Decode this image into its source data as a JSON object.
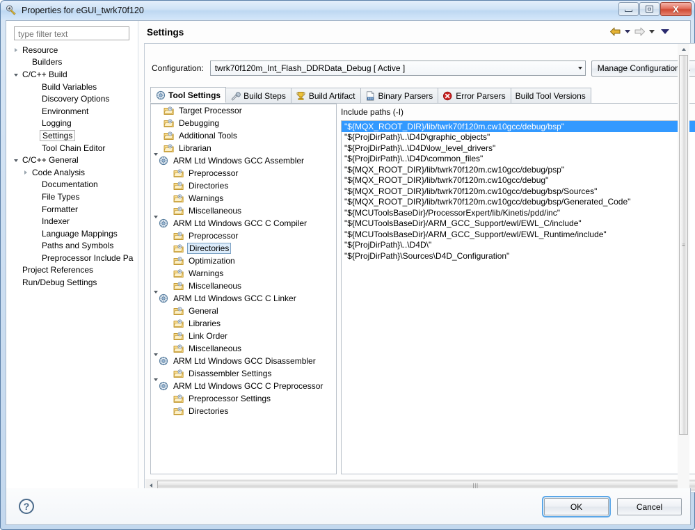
{
  "window": {
    "title": "Properties for eGUI_twrk70f120",
    "icon": "eclipse-properties-icon",
    "controls": {
      "minimize": "Minimize",
      "maximize": "Restore",
      "close": "Close"
    }
  },
  "sidebar": {
    "filter_placeholder": "type filter text",
    "items": [
      {
        "label": "Resource",
        "indent": 0,
        "twisty": "collapsed",
        "selected": false
      },
      {
        "label": "Builders",
        "indent": 1,
        "twisty": "none",
        "selected": false
      },
      {
        "label": "C/C++ Build",
        "indent": 0,
        "twisty": "expanded",
        "selected": false
      },
      {
        "label": "Build Variables",
        "indent": 2,
        "twisty": "none",
        "selected": false
      },
      {
        "label": "Discovery Options",
        "indent": 2,
        "twisty": "none",
        "selected": false
      },
      {
        "label": "Environment",
        "indent": 2,
        "twisty": "none",
        "selected": false
      },
      {
        "label": "Logging",
        "indent": 2,
        "twisty": "none",
        "selected": false
      },
      {
        "label": "Settings",
        "indent": 2,
        "twisty": "none",
        "selected": true
      },
      {
        "label": "Tool Chain Editor",
        "indent": 2,
        "twisty": "none",
        "selected": false
      },
      {
        "label": "C/C++ General",
        "indent": 0,
        "twisty": "expanded",
        "selected": false
      },
      {
        "label": "Code Analysis",
        "indent": 1,
        "twisty": "collapsed",
        "selected": false
      },
      {
        "label": "Documentation",
        "indent": 2,
        "twisty": "none",
        "selected": false
      },
      {
        "label": "File Types",
        "indent": 2,
        "twisty": "none",
        "selected": false
      },
      {
        "label": "Formatter",
        "indent": 2,
        "twisty": "none",
        "selected": false
      },
      {
        "label": "Indexer",
        "indent": 2,
        "twisty": "none",
        "selected": false
      },
      {
        "label": "Language Mappings",
        "indent": 2,
        "twisty": "none",
        "selected": false
      },
      {
        "label": "Paths and Symbols",
        "indent": 2,
        "twisty": "none",
        "selected": false
      },
      {
        "label": "Preprocessor Include Pa",
        "indent": 2,
        "twisty": "none",
        "selected": false
      },
      {
        "label": "Project References",
        "indent": 0,
        "twisty": "none",
        "selected": false
      },
      {
        "label": "Run/Debug Settings",
        "indent": 0,
        "twisty": "none",
        "selected": false
      }
    ]
  },
  "page": {
    "title": "Settings",
    "nav": {
      "back_icon": "back-arrow-icon",
      "back_dropdown_icon": "chevron-down-icon",
      "forward_icon": "forward-arrow-icon",
      "forward_dropdown_icon": "chevron-down-icon",
      "menu_icon": "view-menu-icon"
    }
  },
  "configuration": {
    "label": "Configuration:",
    "value": "twrk70f120m_Int_Flash_DDRData_Debug  [ Active ]",
    "manage_button": "Manage Configurations..."
  },
  "tabs": [
    {
      "label": "Tool Settings",
      "icon": "gear-icon",
      "active": true
    },
    {
      "label": "Build Steps",
      "icon": "wrench-icon",
      "active": false
    },
    {
      "label": "Build Artifact",
      "icon": "trophy-icon",
      "active": false
    },
    {
      "label": "Binary Parsers",
      "icon": "binary-file-icon",
      "active": false
    },
    {
      "label": "Error Parsers",
      "icon": "error-circle-icon",
      "active": false
    },
    {
      "label": "Build Tool Versions",
      "icon": "none",
      "active": false
    }
  ],
  "tool_tree": [
    {
      "label": "Target Processor",
      "indent": 1,
      "twisty": "none",
      "icon": "folder-icon",
      "selected": false
    },
    {
      "label": "Debugging",
      "indent": 1,
      "twisty": "none",
      "icon": "folder-icon",
      "selected": false
    },
    {
      "label": "Additional Tools",
      "indent": 1,
      "twisty": "none",
      "icon": "folder-icon",
      "selected": false
    },
    {
      "label": "Librarian",
      "indent": 1,
      "twisty": "none",
      "icon": "folder-icon",
      "selected": false
    },
    {
      "label": "ARM Ltd Windows GCC Assembler",
      "indent": 0,
      "twisty": "expanded",
      "icon": "gear-icon",
      "selected": false
    },
    {
      "label": "Preprocessor",
      "indent": 2,
      "twisty": "none",
      "icon": "folder-icon",
      "selected": false
    },
    {
      "label": "Directories",
      "indent": 2,
      "twisty": "none",
      "icon": "folder-icon",
      "selected": false
    },
    {
      "label": "Warnings",
      "indent": 2,
      "twisty": "none",
      "icon": "folder-icon",
      "selected": false
    },
    {
      "label": "Miscellaneous",
      "indent": 2,
      "twisty": "none",
      "icon": "folder-icon",
      "selected": false
    },
    {
      "label": "ARM Ltd Windows GCC C Compiler",
      "indent": 0,
      "twisty": "expanded",
      "icon": "gear-icon",
      "selected": false
    },
    {
      "label": "Preprocessor",
      "indent": 2,
      "twisty": "none",
      "icon": "folder-icon",
      "selected": false
    },
    {
      "label": "Directories",
      "indent": 2,
      "twisty": "none",
      "icon": "folder-icon",
      "selected": true
    },
    {
      "label": "Optimization",
      "indent": 2,
      "twisty": "none",
      "icon": "folder-icon",
      "selected": false
    },
    {
      "label": "Warnings",
      "indent": 2,
      "twisty": "none",
      "icon": "folder-icon",
      "selected": false
    },
    {
      "label": "Miscellaneous",
      "indent": 2,
      "twisty": "none",
      "icon": "folder-icon",
      "selected": false
    },
    {
      "label": "ARM Ltd Windows GCC C Linker",
      "indent": 0,
      "twisty": "expanded",
      "icon": "gear-icon",
      "selected": false
    },
    {
      "label": "General",
      "indent": 2,
      "twisty": "none",
      "icon": "folder-icon",
      "selected": false
    },
    {
      "label": "Libraries",
      "indent": 2,
      "twisty": "none",
      "icon": "folder-icon",
      "selected": false
    },
    {
      "label": "Link Order",
      "indent": 2,
      "twisty": "none",
      "icon": "folder-icon",
      "selected": false
    },
    {
      "label": "Miscellaneous",
      "indent": 2,
      "twisty": "none",
      "icon": "folder-icon",
      "selected": false
    },
    {
      "label": "ARM Ltd Windows GCC Disassembler",
      "indent": 0,
      "twisty": "expanded",
      "icon": "gear-icon",
      "selected": false
    },
    {
      "label": "Disassembler Settings",
      "indent": 2,
      "twisty": "none",
      "icon": "folder-icon",
      "selected": false
    },
    {
      "label": "ARM Ltd Windows GCC C Preprocessor",
      "indent": 0,
      "twisty": "expanded",
      "icon": "gear-icon",
      "selected": false
    },
    {
      "label": "Preprocessor Settings",
      "indent": 2,
      "twisty": "none",
      "icon": "folder-icon",
      "selected": false
    },
    {
      "label": "Directories",
      "indent": 2,
      "twisty": "none",
      "icon": "folder-icon",
      "selected": false
    }
  ],
  "include_paths": {
    "title": "Include paths (-I)",
    "toolbar": [
      {
        "name": "add-path-button",
        "icon": "add-file-icon",
        "enabled": true
      },
      {
        "name": "delete-path-button",
        "icon": "delete-file-icon",
        "enabled": true
      },
      {
        "name": "edit-path-button",
        "icon": "edit-file-icon",
        "enabled": true
      },
      {
        "name": "move-up-button",
        "icon": "move-up-icon",
        "enabled": false
      },
      {
        "name": "move-down-button",
        "icon": "move-down-icon",
        "enabled": true
      }
    ],
    "selected_index": 0,
    "items": [
      "\"${MQX_ROOT_DIR}/lib/twrk70f120m.cw10gcc/debug/bsp\"",
      "\"${ProjDirPath}\\..\\D4D\\graphic_objects\"",
      "\"${ProjDirPath}\\..\\D4D\\low_level_drivers\"",
      "\"${ProjDirPath}\\..\\D4D\\common_files\"",
      "\"${MQX_ROOT_DIR}/lib/twrk70f120m.cw10gcc/debug/psp\"",
      "\"${MQX_ROOT_DIR}/lib/twrk70f120m.cw10gcc/debug\"",
      "\"${MQX_ROOT_DIR}/lib/twrk70f120m.cw10gcc/debug/bsp/Sources\"",
      "\"${MQX_ROOT_DIR}/lib/twrk70f120m.cw10gcc/debug/bsp/Generated_Code\"",
      "\"${MCUToolsBaseDir}/ProcessorExpert/lib/Kinetis/pdd/inc\"",
      "\"${MCUToolsBaseDir}/ARM_GCC_Support/ewl/EWL_C/include\"",
      "\"${MCUToolsBaseDir}/ARM_GCC_Support/ewl/EWL_Runtime/include\"",
      "\"${ProjDirPath}\\..\\D4D\\\"",
      "\"${ProjDirPath}\\Sources\\D4D_Configuration\""
    ]
  },
  "footer": {
    "help_icon": "help-icon",
    "help_glyph": "?",
    "ok": "OK",
    "cancel": "Cancel"
  },
  "colors": {
    "selection_blue": "#3399ff",
    "tree_selection": "#dcecfb",
    "title_bar": "#cfe2f6",
    "close_button": "#cf4a35",
    "focus_ring": "#5ba7e8"
  }
}
